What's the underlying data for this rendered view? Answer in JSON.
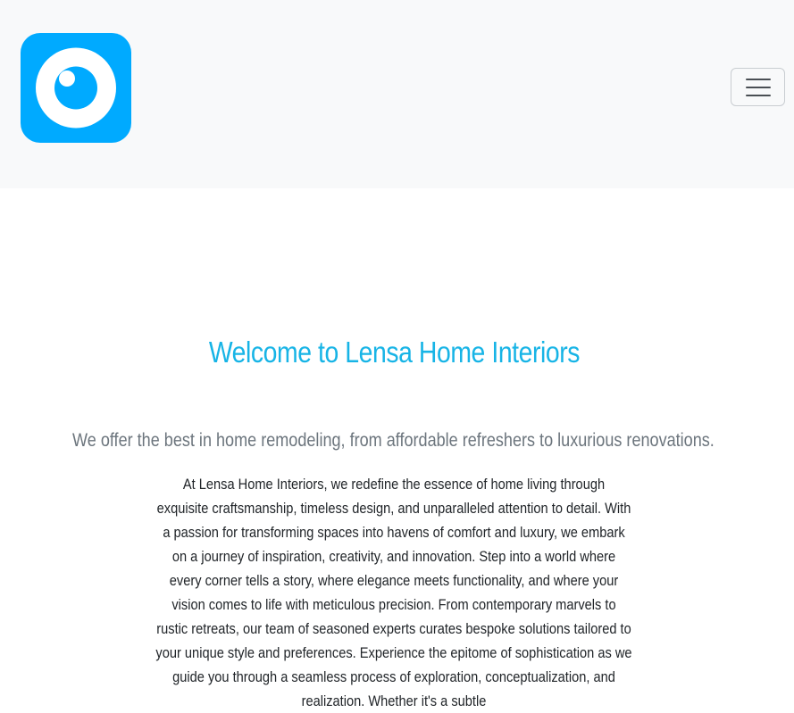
{
  "navbar": {
    "logo_icon": "eye-logo-icon",
    "brand_color": "#00aaff",
    "toggler_icon": "hamburger-menu-icon"
  },
  "hero": {
    "title": "Welcome to Lensa Home Interiors",
    "title_color": "#17b4e6",
    "lead": "We offer the best in home remodeling, from affordable refreshers to luxurious renovations.",
    "body": "At Lensa Home Interiors, we redefine the essence of home living through exquisite craftsmanship, timeless design, and unparalleled attention to detail. With a passion for transforming spaces into havens of comfort and luxury, we embark on a journey of inspiration, creativity, and innovation. Step into a world where every corner tells a story, where elegance meets functionality, and where your vision comes to life with meticulous precision. From contemporary marvels to rustic retreats, our team of seasoned experts curates bespoke solutions tailored to your unique style and preferences. Experience the epitome of sophistication as we guide you through a seamless process of exploration, conceptualization, and realization. Whether it's a subtle"
  }
}
